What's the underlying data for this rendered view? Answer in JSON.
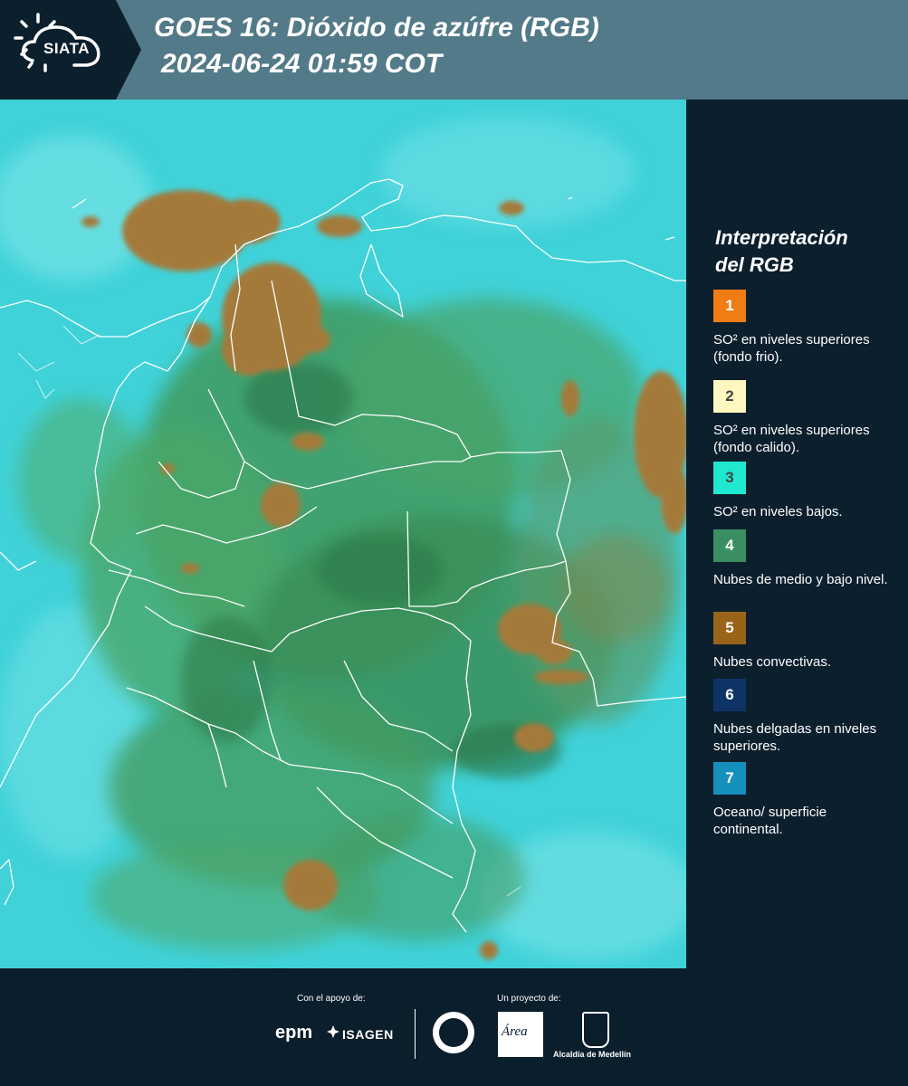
{
  "header": {
    "logo_text": "SIATA",
    "title_line1": "GOES 16: Dióxido de azúfre (RGB)",
    "title_line2": "2024-06-24 01:59 COT"
  },
  "legend": {
    "title_line1": "Interpretación",
    "title_line2": "del RGB",
    "items": [
      {
        "num": "1",
        "color": "#f07d14",
        "numcolor": "#ffffff",
        "text": "SO² en niveles superiores (fondo frio)."
      },
      {
        "num": "2",
        "color": "#fff7c0",
        "numcolor": "#444444",
        "text": "SO² en niveles superiores (fondo calido)."
      },
      {
        "num": "3",
        "color": "#1ee8d0",
        "numcolor": "#444444",
        "text": "SO² en niveles bajos."
      },
      {
        "num": "4",
        "color": "#3a8f62",
        "numcolor": "#ffffff",
        "text": "Nubes de medio y bajo nivel."
      },
      {
        "num": "5",
        "color": "#9a6418",
        "numcolor": "#ffffff",
        "text": "Nubes convectivas."
      },
      {
        "num": "6",
        "color": "#0e3466",
        "numcolor": "#ffffff",
        "text": "Nubes delgadas en niveles superiores."
      },
      {
        "num": "7",
        "color": "#1590bc",
        "numcolor": "#ffffff",
        "text": "Oceano/ superficie continental."
      }
    ]
  },
  "footer": {
    "support_label": "Con el apoyo de:",
    "project_label": "Un proyecto de:",
    "epm": "epm",
    "isagen": "ISAGEN",
    "area": "Área",
    "alcaldia": "Alcaldía de Medellín"
  },
  "colors": {
    "cyan": "#3fd2d8",
    "green": "#3f9a5e",
    "convective": "#a47a3a"
  }
}
